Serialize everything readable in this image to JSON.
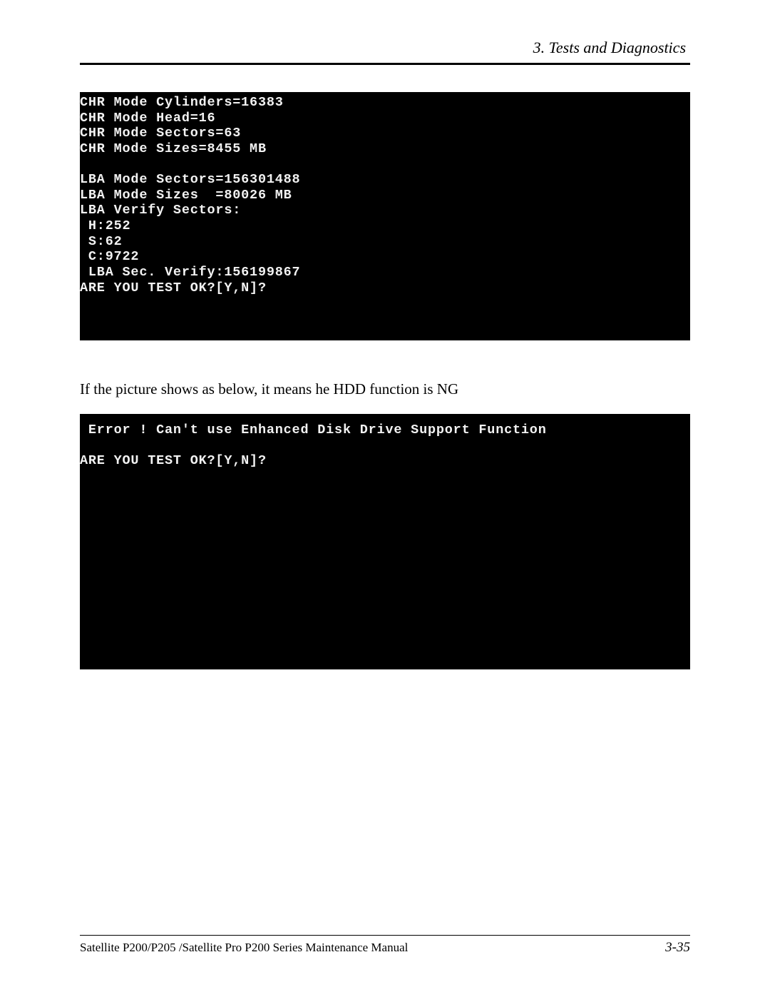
{
  "header": {
    "chapter_title": "3.  Tests and Diagnostics"
  },
  "terminal1": {
    "lines": "CHR Mode Cylinders=16383\nCHR Mode Head=16\nCHR Mode Sectors=63\nCHR Mode Sizes=8455 MB\n\nLBA Mode Sectors=156301488\nLBA Mode Sizes  =80026 MB\nLBA Verify Sectors:\n H:252\n S:62\n C:9722\n LBA Sec. Verify:156199867\nARE YOU TEST OK?[Y,N]?"
  },
  "middle_text": "If the picture shows as below, it means he HDD function is NG",
  "terminal2": {
    "lines": " Error ! Can't use Enhanced Disk Drive Support Function\n\nARE YOU TEST OK?[Y,N]?"
  },
  "footer": {
    "manual_title": "Satellite P200/P205 /Satellite Pro P200 Series Maintenance Manual",
    "page_number": "3-35"
  }
}
